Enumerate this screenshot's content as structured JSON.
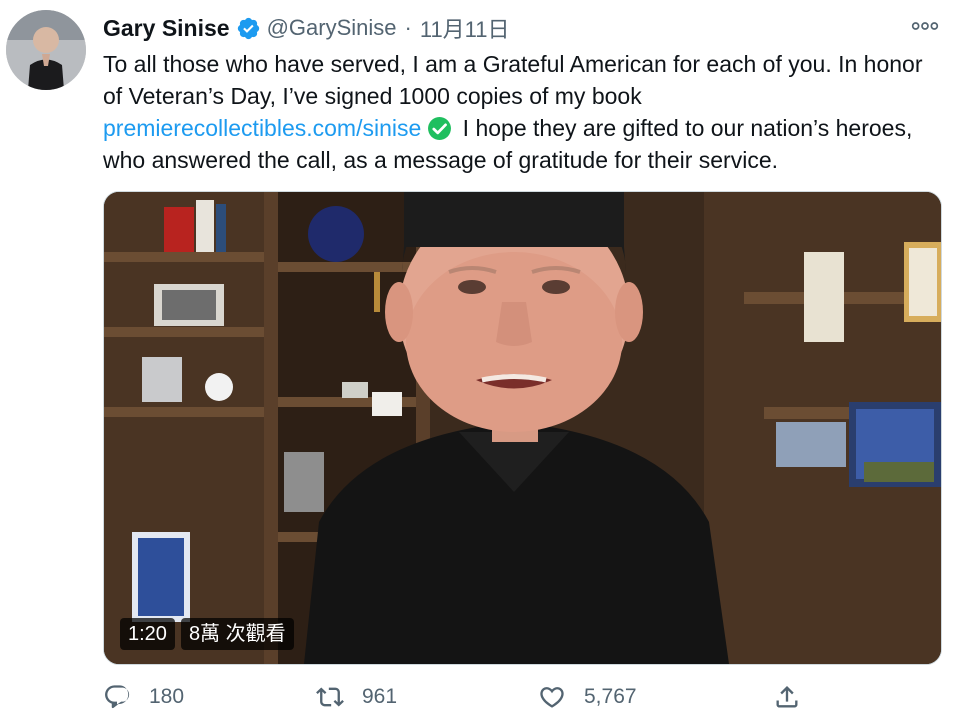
{
  "author": {
    "name": "Gary Sinise",
    "handle": "@GarySinise",
    "separator": "·",
    "date": "11月11日"
  },
  "tweet": {
    "text_part1": "To all those who have served, I am a Grateful American for each of you. In honor of Veteran’s Day, I’ve signed 1000 copies of my book ",
    "link": "premierecollectibles.com/sinise",
    "text_part2": " I hope they are gifted to our nation’s heroes, who answered the call, as a message of gratitude for their service."
  },
  "video": {
    "duration": "1:20",
    "views": "8萬 次觀看"
  },
  "actions": {
    "replies": "180",
    "retweets": "961",
    "likes": "5,767"
  },
  "icons": {
    "verified": "verified-badge-icon",
    "check": "check-mark-emoji-icon",
    "more": "more-options-icon",
    "reply": "reply-icon",
    "retweet": "retweet-icon",
    "like": "heart-icon",
    "share": "share-icon"
  },
  "colors": {
    "accent": "#1d9bf0",
    "secondary_text": "#536471",
    "check_emoji": "#1fbf5f"
  }
}
